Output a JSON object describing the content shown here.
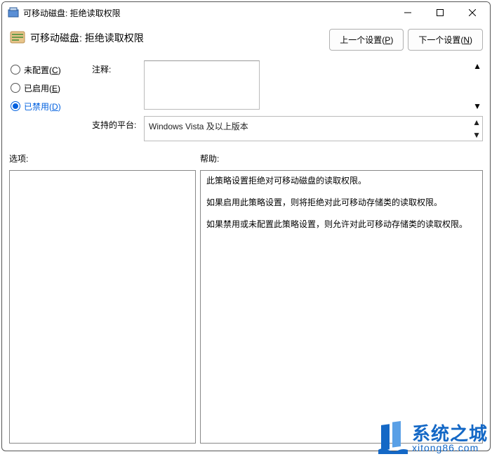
{
  "titlebar": {
    "title": "可移动磁盘: 拒绝读取权限"
  },
  "header": {
    "title": "可移动磁盘: 拒绝读取权限",
    "prev_btn": "上一个设置",
    "prev_key": "P",
    "next_btn": "下一个设置",
    "next_key": "N"
  },
  "radios": {
    "not_configured": {
      "label": "未配置",
      "key": "C",
      "selected": false
    },
    "enabled": {
      "label": "已启用",
      "key": "E",
      "selected": false
    },
    "disabled": {
      "label": "已禁用",
      "key": "D",
      "selected": true
    }
  },
  "fields": {
    "comment_label": "注释:",
    "comment_value": "",
    "platform_label": "支持的平台:",
    "platform_value": "Windows Vista 及以上版本"
  },
  "sections": {
    "options_label": "选项:",
    "help_label": "帮助:"
  },
  "help_text": {
    "p1": "此策略设置拒绝对可移动磁盘的读取权限。",
    "p2": "如果启用此策略设置，则将拒绝对此可移动存储类的读取权限。",
    "p3": "如果禁用或未配置此策略设置，则允许对此可移动存储类的读取权限。"
  },
  "watermark": {
    "name": "系统之城",
    "url": "xitong86.com"
  }
}
